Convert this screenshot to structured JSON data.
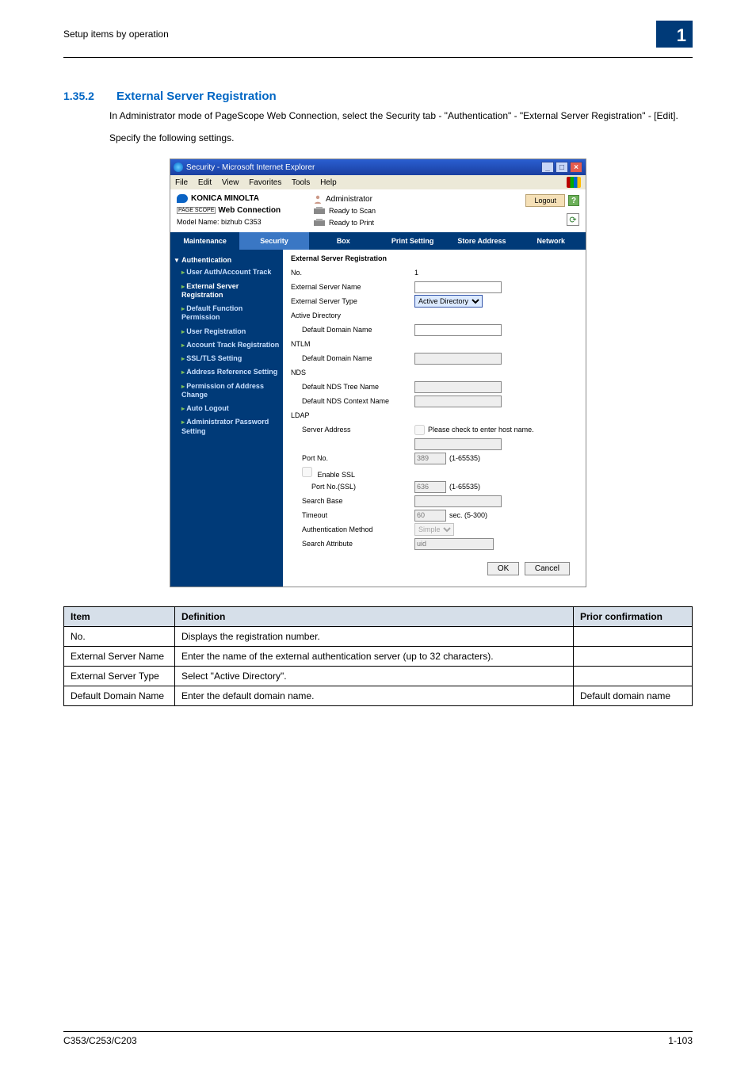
{
  "header": {
    "breadcrumb": "Setup items by operation",
    "page_badge": "1"
  },
  "section": {
    "number": "1.35.2",
    "title": "External Server Registration",
    "p1": "In Administrator mode of PageScope Web Connection, select the Security tab - \"Authentication\" - \"External Server Registration\" - [Edit].",
    "p2": "Specify the following settings."
  },
  "ie": {
    "title": "Security - Microsoft Internet Explorer",
    "menus": [
      "File",
      "Edit",
      "View",
      "Favorites",
      "Tools",
      "Help"
    ]
  },
  "wc": {
    "brand": "KONICA MINOLTA",
    "product_prefix": "PAGE SCOPE",
    "product": "Web Connection",
    "model_label": "Model Name:",
    "model_value": "bizhub C353",
    "admin_label": "Administrator",
    "ready_scan": "Ready to Scan",
    "ready_print": "Ready to Print",
    "logout": "Logout",
    "tabs": [
      "Maintenance",
      "Security",
      "Box",
      "Print Setting",
      "Store Address",
      "Network"
    ],
    "active_tab_index": 1
  },
  "sidebar": {
    "head": "Authentication",
    "items": [
      {
        "label": "User Auth/Account Track",
        "bold": true
      },
      {
        "label": "External Server Registration",
        "bold": true,
        "current": true
      },
      {
        "label": "Default Function Permission",
        "bold": true
      },
      {
        "label": "User Registration",
        "bold": true
      },
      {
        "label": "Account Track Registration",
        "bold": true
      },
      {
        "label": "SSL/TLS Setting",
        "bold": true
      },
      {
        "label": "Address Reference Setting",
        "bold": true
      },
      {
        "label": "Permission of Address Change",
        "bold": true
      },
      {
        "label": "Auto Logout",
        "bold": true
      },
      {
        "label": "Administrator Password Setting",
        "bold": true
      }
    ]
  },
  "form": {
    "title": "External Server Registration",
    "rows": {
      "no_label": "No.",
      "no_value": "1",
      "esn_label": "External Server Name",
      "est_label": "External Server Type",
      "est_value": "Active Directory",
      "ad_group": "Active Directory",
      "ad_ddn_label": "Default Domain Name",
      "ntlm_group": "NTLM",
      "ntlm_ddn_label": "Default Domain Name",
      "nds_group": "NDS",
      "nds_tree_label": "Default NDS Tree Name",
      "nds_ctx_label": "Default NDS Context Name",
      "ldap_group": "LDAP",
      "ldap_sa_label": "Server Address",
      "ldap_sa_hint": "Please check to enter host name.",
      "port_label": "Port No.",
      "port_value": "389",
      "port_hint": "(1-65535)",
      "ssl_label": "Enable SSL",
      "portssl_label": "Port No.(SSL)",
      "portssl_value": "636",
      "portssl_hint": "(1-65535)",
      "sb_label": "Search Base",
      "timeout_label": "Timeout",
      "timeout_value": "60",
      "timeout_hint": "sec. (5-300)",
      "auth_label": "Authentication Method",
      "auth_value": "Simple",
      "attr_label": "Search Attribute",
      "attr_value": "uid"
    },
    "ok": "OK",
    "cancel": "Cancel"
  },
  "table": {
    "headers": [
      "Item",
      "Definition",
      "Prior confirmation"
    ],
    "rows": [
      {
        "item": "No.",
        "def": "Displays the registration number.",
        "pc": ""
      },
      {
        "item": "External Server Name",
        "def": "Enter the name of the external authentication server (up to 32 characters).",
        "pc": ""
      },
      {
        "item": "External Server Type",
        "def": "Select \"Active Directory\".",
        "pc": ""
      },
      {
        "item": "Default Domain Name",
        "def": "Enter the default domain name.",
        "pc": "Default domain name"
      }
    ]
  },
  "footer": {
    "left": "C353/C253/C203",
    "right": "1-103"
  }
}
